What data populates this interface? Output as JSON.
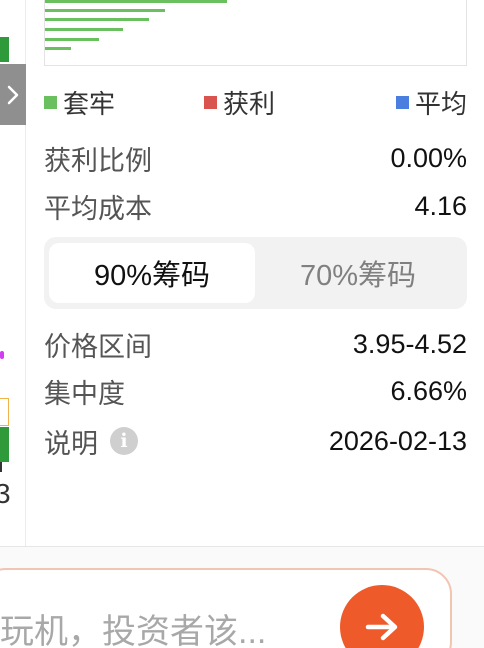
{
  "left_strip": {
    "partial_number": "3",
    "toggle_icon": "chevron-right-icon"
  },
  "legend": {
    "trapped": {
      "label": "套牢",
      "color": "#6abf5e"
    },
    "profit": {
      "label": "获利",
      "color": "#d9534f"
    },
    "average": {
      "label": "平均",
      "color": "#4a7fe0"
    }
  },
  "stats": {
    "profit_ratio": {
      "label": "获利比例",
      "value": "0.00%"
    },
    "avg_cost": {
      "label": "平均成本",
      "value": "4.16"
    }
  },
  "segment": {
    "active": "90%筹码",
    "inactive": "70%筹码"
  },
  "chip_stats": {
    "price_range": {
      "label": "价格区间",
      "value": "3.95-4.52"
    },
    "concentration": {
      "label": "集中度",
      "value": "6.66%"
    },
    "note": {
      "label": "说明",
      "value": "2026-02-13",
      "icon": "info-icon"
    }
  },
  "ask_bar": {
    "placeholder": "玩机，投资者该...",
    "send_icon": "arrow-right-icon"
  },
  "colors": {
    "accent": "#ef5a2a",
    "green": "#2e9a3a"
  }
}
